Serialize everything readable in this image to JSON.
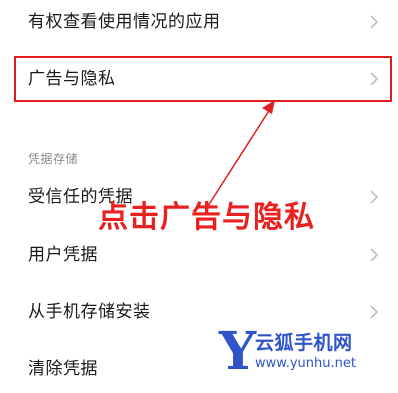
{
  "settings_list": {
    "items": [
      {
        "label": "有权查看使用情况的应用"
      },
      {
        "label": "广告与隐私"
      }
    ],
    "credentials_section": {
      "header": "凭据存储",
      "items": [
        {
          "label": "受信任的凭据"
        },
        {
          "label": "用户凭据"
        },
        {
          "label": "从手机存储安装"
        },
        {
          "label": "清除凭据"
        }
      ]
    }
  },
  "annotation": {
    "text": "点击广告与隐私",
    "color": "#e82020"
  },
  "watermark": {
    "logo_letter": "Y",
    "name": "云狐手机网",
    "url": "www.yunhu.net",
    "color": "#2f55c8"
  },
  "icons": {
    "row_chevron": "chevron-right-icon"
  }
}
